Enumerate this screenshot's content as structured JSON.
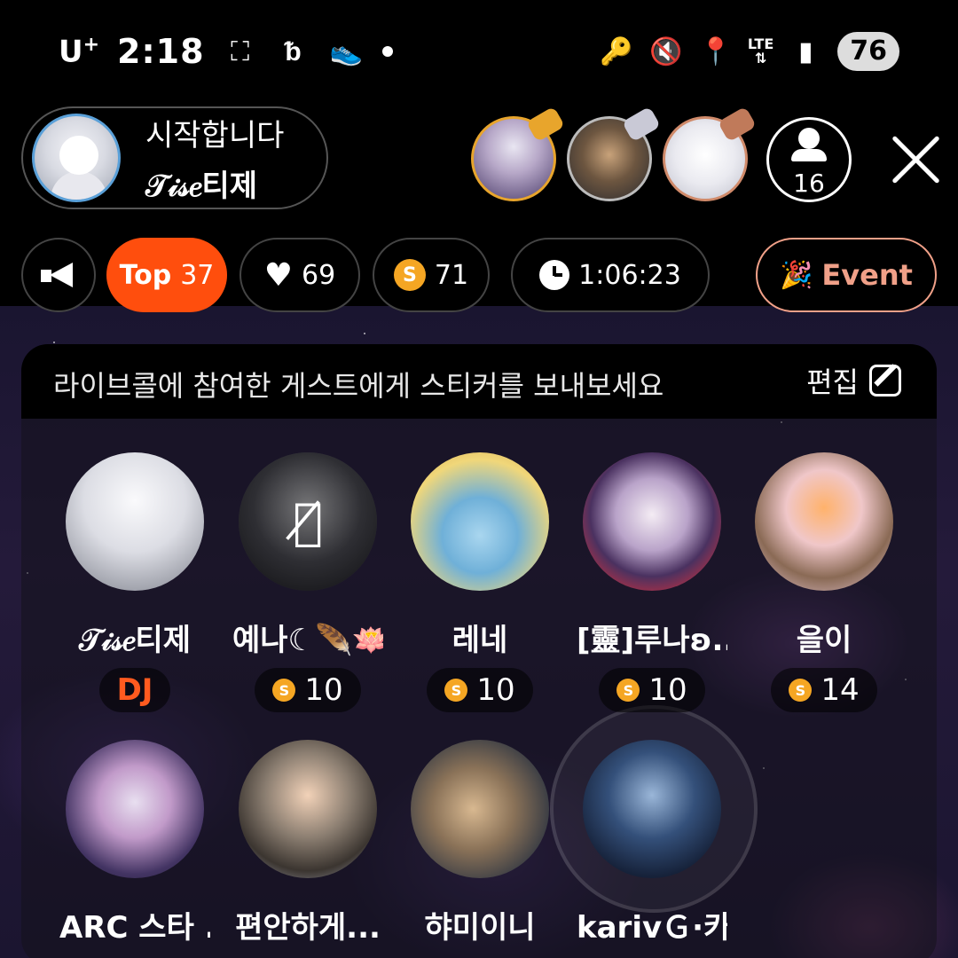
{
  "status": {
    "carrier": "U",
    "carrier_sup": "+",
    "time": "2:18",
    "battery": "76",
    "network": "LTE"
  },
  "host": {
    "title": "시작합니다",
    "name": "𝒯𝒾𝓈𝑒티제"
  },
  "viewers": {
    "count": "16"
  },
  "chips": {
    "top_label": "Top",
    "top_num": "37",
    "likes": "69",
    "coins": "71",
    "coin_symbol": "S",
    "timer": "1:06:23",
    "event": "Event"
  },
  "panel": {
    "message": "라이브콜에 참여한 게스트에게 스티커를 보내보세요",
    "edit_label": "편집"
  },
  "guests": [
    {
      "name": "𝒯𝒾𝓈𝑒티제",
      "badge": "DJ"
    },
    {
      "name": "예나☾🪶🪷",
      "badge": "10"
    },
    {
      "name": "레네",
      "badge": "10"
    },
    {
      "name": "[靈]루나ʚ...",
      "badge": "10"
    },
    {
      "name": "을이",
      "badge": "14"
    },
    {
      "name": "ARC 스타 ...",
      "badge": ""
    },
    {
      "name": "편안하게...",
      "badge": ""
    },
    {
      "name": "햐미이니",
      "badge": ""
    },
    {
      "name": "karivＧ·카...",
      "badge": ""
    }
  ],
  "colors": {
    "accent": "#ff4e0d",
    "event": "#f0a088",
    "coin": "#f5a623",
    "dj": "#ff5a1f"
  }
}
